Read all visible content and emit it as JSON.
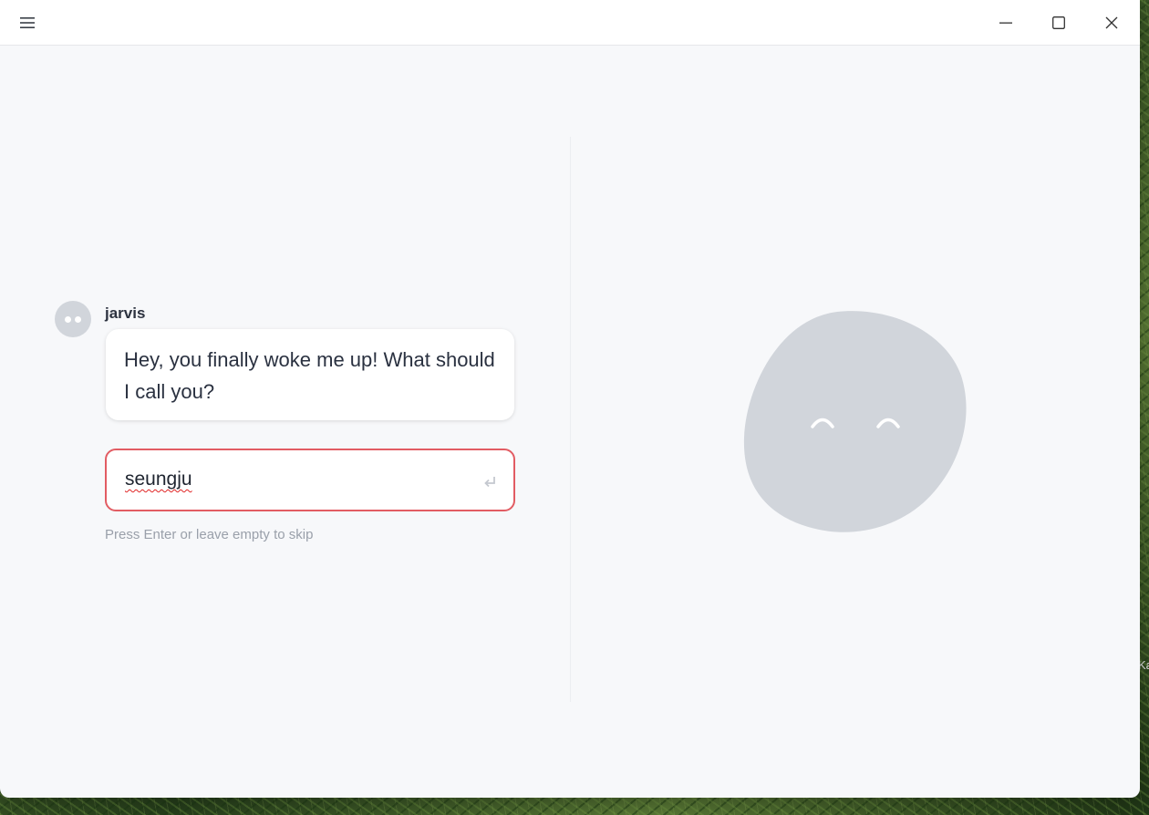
{
  "desktop": {
    "peek_text": "Ka"
  },
  "titlebar": {
    "menu_icon": "hamburger-menu-icon",
    "minimize_icon": "minimize-icon",
    "maximize_icon": "maximize-icon",
    "close_icon": "close-icon"
  },
  "chat": {
    "sender_name": "jarvis",
    "message": "Hey, you finally woke me up! What should I call you?",
    "input_value": "seungju",
    "enter_icon": "enter-return-icon",
    "hint": "Press Enter or leave empty to skip"
  },
  "character": {
    "color": "#d1d5db",
    "expression": "happy-closed-eyes"
  },
  "colors": {
    "input_border": "#e25c63",
    "window_bg": "#f7f8fa"
  }
}
